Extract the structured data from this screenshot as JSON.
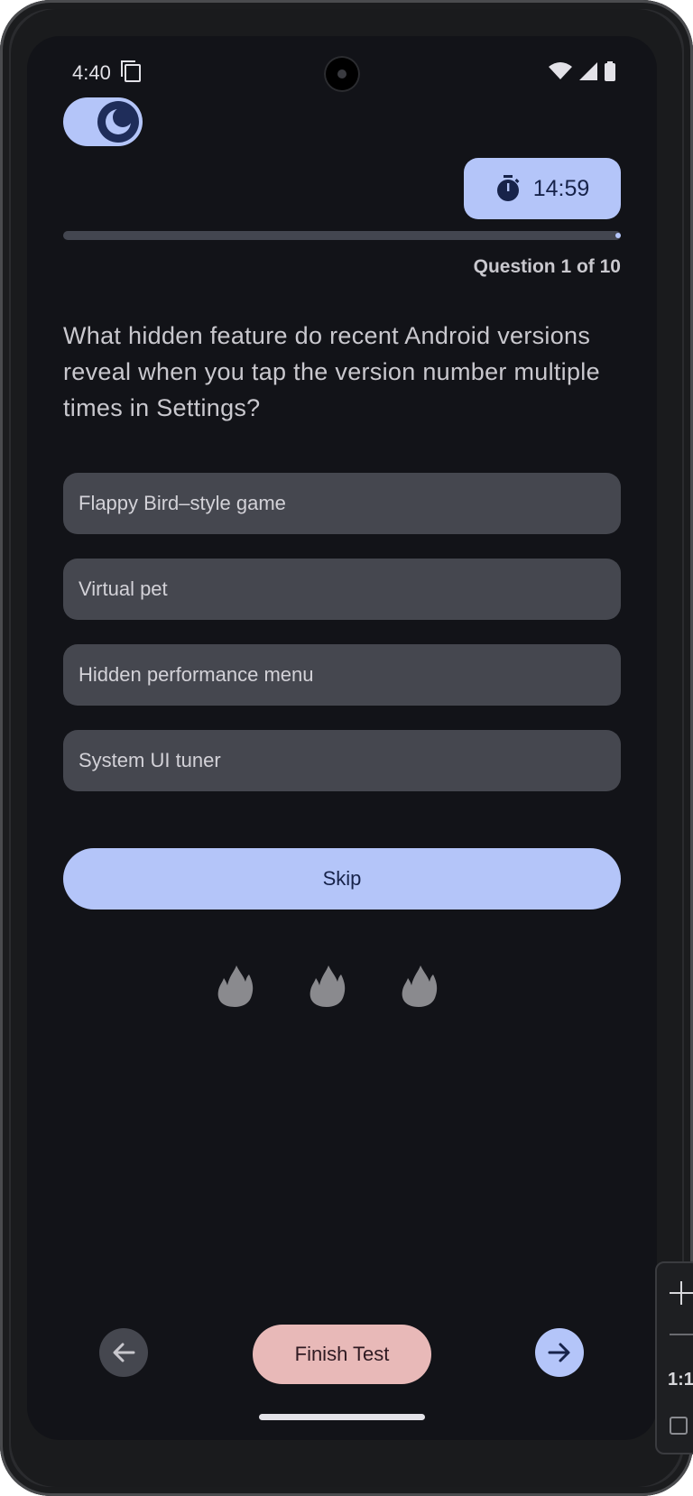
{
  "status_bar": {
    "time": "4:40"
  },
  "timer": {
    "value": "14:59",
    "icon": "stopwatch-icon"
  },
  "progress": {
    "fraction": 1.0,
    "label": "Question 1 of 10"
  },
  "question": {
    "text": "What hidden feature do recent Android versions reveal when you tap the version number multiple times in Settings?"
  },
  "options": [
    {
      "label": "Flappy Bird–style game"
    },
    {
      "label": "Virtual pet"
    },
    {
      "label": "Hidden performance menu"
    },
    {
      "label": "System UI tuner"
    }
  ],
  "skip": {
    "label": "Skip"
  },
  "streak": {
    "icon": "flame-icon",
    "count": 3,
    "color": "#8a8a8e"
  },
  "nav": {
    "finish_label": "Finish Test",
    "prev_icon": "arrow-left-icon",
    "next_icon": "arrow-right-icon"
  },
  "emulator_toolbar": {
    "ratio_label": "1:1"
  },
  "colors": {
    "background": "#121318",
    "primary_container": "#b4c5f9",
    "option_surface": "#45474f",
    "finish_button": "#e8b9b8"
  }
}
